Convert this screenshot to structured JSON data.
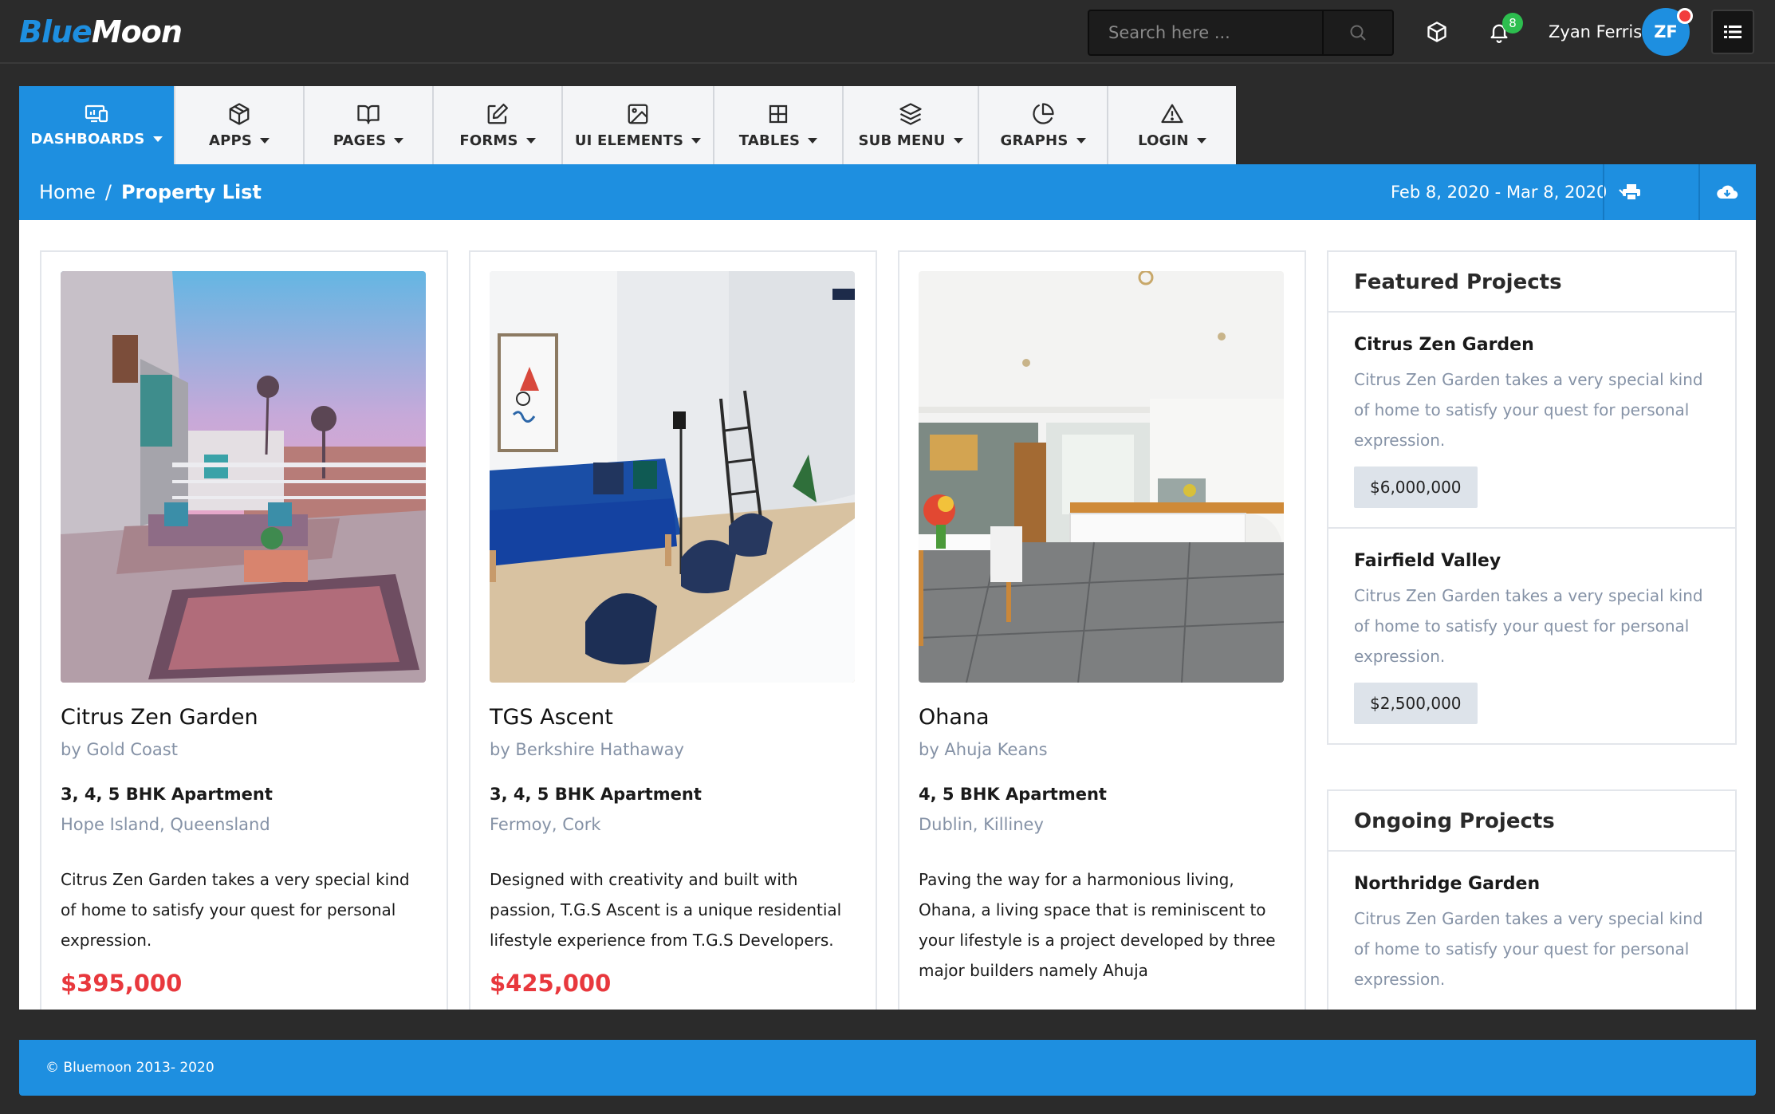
{
  "brand": {
    "part1": "Blue",
    "part2": "Moon"
  },
  "header": {
    "search_placeholder": "Search here ...",
    "notification_count": "8",
    "user_name": "Zyan Ferris",
    "user_initials": "ZF"
  },
  "nav": {
    "items": [
      {
        "label": "DASHBOARDS",
        "icon": "dashboard-icon"
      },
      {
        "label": "APPS",
        "icon": "cube-icon"
      },
      {
        "label": "PAGES",
        "icon": "book-icon"
      },
      {
        "label": "FORMS",
        "icon": "edit-icon"
      },
      {
        "label": "UI ELEMENTS",
        "icon": "image-icon"
      },
      {
        "label": "TABLES",
        "icon": "grid-icon"
      },
      {
        "label": "SUB MENU",
        "icon": "layers-icon"
      },
      {
        "label": "GRAPHS",
        "icon": "pie-chart-icon"
      },
      {
        "label": "LOGIN",
        "icon": "alert-triangle-icon"
      }
    ]
  },
  "breadcrumb": {
    "home": "Home",
    "separator": "/",
    "current": "Property List",
    "date_range": "Feb 8, 2020 - Mar 8, 2020"
  },
  "properties": [
    {
      "name": "Citrus Zen Garden",
      "by": "by Gold Coast",
      "bhk": "3, 4, 5 BHK Apartment",
      "location": "Hope Island, Queensland",
      "description": "Citrus Zen Garden takes a very special kind of home to satisfy your quest for personal expression.",
      "price": "$395,000"
    },
    {
      "name": "TGS Ascent",
      "by": "by Berkshire Hathaway",
      "bhk": "3, 4, 5 BHK Apartment",
      "location": "Fermoy, Cork",
      "description": "Designed with creativity and built with passion, T.G.S Ascent is a unique residential lifestyle experience from T.G.S Developers.",
      "price": "$425,000"
    },
    {
      "name": "Ohana",
      "by": "by Ahuja Keans",
      "bhk": "4, 5 BHK Apartment",
      "location": "Dublin, Killiney",
      "description": "Paving the way for a harmonious living, Ohana, a living space that is reminiscent to your lifestyle is a project developed by three major builders namely Ahuja",
      "price": ""
    }
  ],
  "featured": {
    "title": "Featured Projects",
    "items": [
      {
        "title": "Citrus Zen Garden",
        "description": "Citrus Zen Garden takes a very special kind of home to satisfy your quest for personal expression.",
        "price": "$6,000,000"
      },
      {
        "title": "Fairfield Valley",
        "description": "Citrus Zen Garden takes a very special kind of home to satisfy your quest for personal expression.",
        "price": "$2,500,000"
      }
    ]
  },
  "ongoing": {
    "title": "Ongoing Projects",
    "items": [
      {
        "title": "Northridge Garden",
        "description": "Citrus Zen Garden takes a very special kind of home to satisfy your quest for personal expression."
      }
    ]
  },
  "footer": {
    "text": "© Bluemoon 2013- 2020"
  },
  "colors": {
    "accent": "#1e8fe0",
    "price": "#e8383d",
    "muted": "#8592a6",
    "header_bg": "#2b2b2b"
  }
}
